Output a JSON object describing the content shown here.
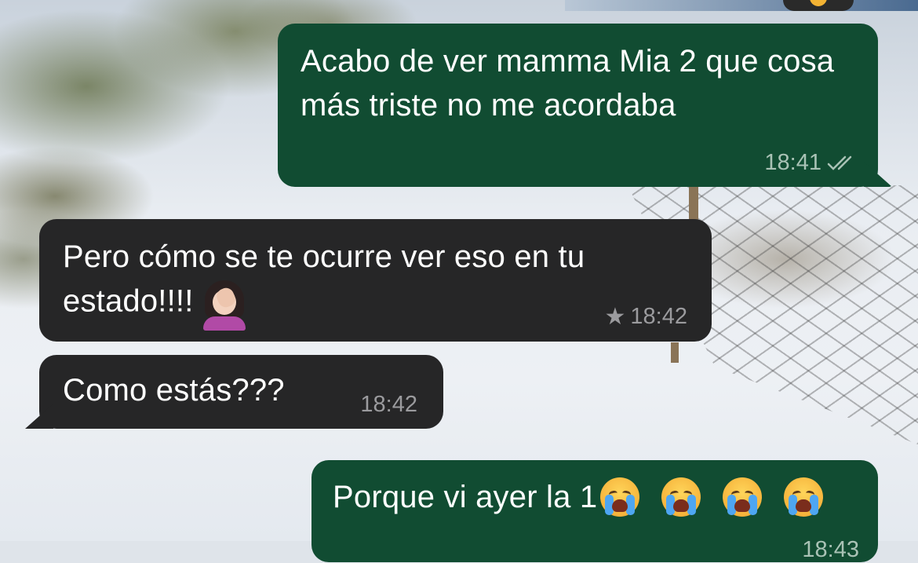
{
  "chat": {
    "messages": [
      {
        "direction": "outgoing",
        "text": "Acabo de ver mamma Mia 2 que cosa más triste no me acordaba",
        "time": "18:41",
        "status_icon": "double-check-icon"
      },
      {
        "direction": "incoming",
        "text": "Pero cómo se te ocurre ver eso en tu estado!!!!",
        "emoji": "woman-facepalming-emoji",
        "time": "18:42",
        "starred": true,
        "star_icon": "star-icon"
      },
      {
        "direction": "incoming",
        "text": "Como estás???",
        "time": "18:42"
      },
      {
        "direction": "outgoing",
        "text": "Porque vi ayer la 1",
        "emojis": [
          "loudly-crying-face-emoji",
          "loudly-crying-face-emoji",
          "loudly-crying-face-emoji",
          "loudly-crying-face-emoji"
        ],
        "time": "18:43"
      }
    ]
  },
  "colors": {
    "outgoing_bubble": "#114c32",
    "incoming_bubble": "#262627",
    "text": "#ffffff"
  }
}
